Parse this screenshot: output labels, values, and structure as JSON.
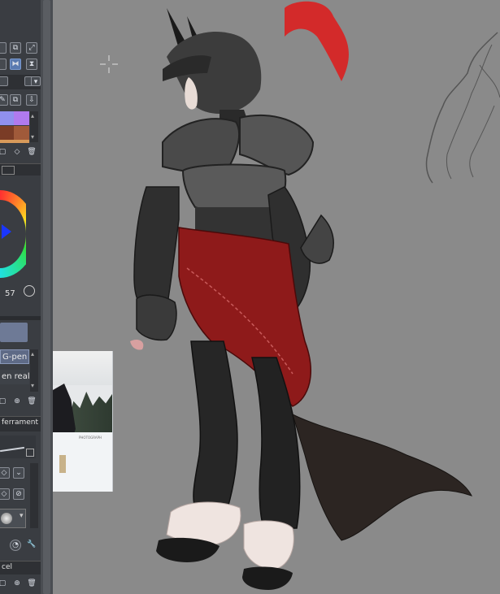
{
  "sidebar": {
    "color_wheel_value": "57",
    "brush_active": "G-pen",
    "brush_secondary": "en real",
    "sub_tool_tab": "ferrament",
    "bottom_tab": "cel"
  },
  "colors": {
    "panel_bg": "#3a3d42",
    "canvas_bg": "#8a8a8a",
    "accent_blue": "#5a7ab0",
    "plume_red": "#d32a2a",
    "sash_red": "#8e1a1a"
  },
  "canvas": {
    "reference_photo_caption": "PHOTOGRAPH"
  }
}
